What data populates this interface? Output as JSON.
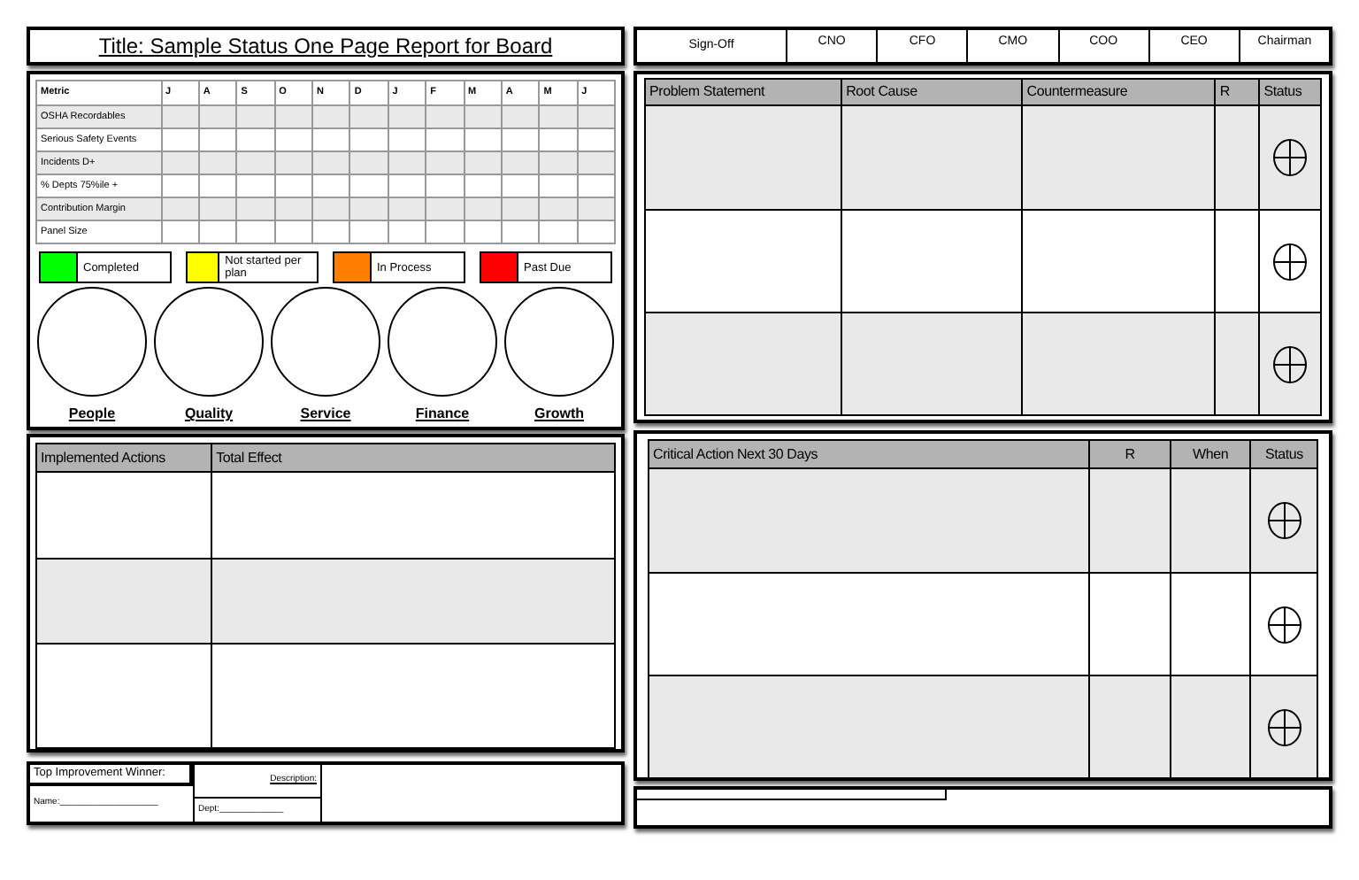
{
  "title": "Title:  Sample Status One Page Report for Board",
  "sign_off": {
    "label": "Sign-Off",
    "roles": [
      "CNO",
      "CFO",
      "CMO",
      "COO",
      "CEO",
      "Chairman"
    ]
  },
  "metrics": {
    "columns": [
      "Metric",
      "J",
      "A",
      "S",
      "O",
      "N",
      "D",
      "J",
      "F",
      "M",
      "A",
      "M",
      "J"
    ],
    "rows": [
      "OSHA Recordables",
      "Serious Safety Events",
      "Incidents D+",
      "% Depts 75%ile +",
      "Contribution Margin",
      "Panel Size"
    ]
  },
  "legend": [
    {
      "label": "Completed",
      "color": "#00ff00"
    },
    {
      "label": "Not started per plan",
      "color": "#ffff00"
    },
    {
      "label": "In Process",
      "color": "#ff8000"
    },
    {
      "label": "Past Due",
      "color": "#ff0000"
    }
  ],
  "categories": [
    "People",
    "Quality",
    "Service",
    "Finance",
    "Growth"
  ],
  "implemented": {
    "columns": [
      "Implemented Actions",
      "Total Effect"
    ]
  },
  "winner": {
    "label": "Top Improvement Winner:",
    "name": "Name:____________________",
    "description": "Description:",
    "dept": "Dept:_____________"
  },
  "problems": {
    "columns": [
      "Problem Statement",
      "Root Cause",
      "Countermeasure",
      "R",
      "Status"
    ]
  },
  "critical": {
    "columns": [
      "Critical Action Next 30 Days",
      "R",
      "When",
      "Status"
    ]
  }
}
